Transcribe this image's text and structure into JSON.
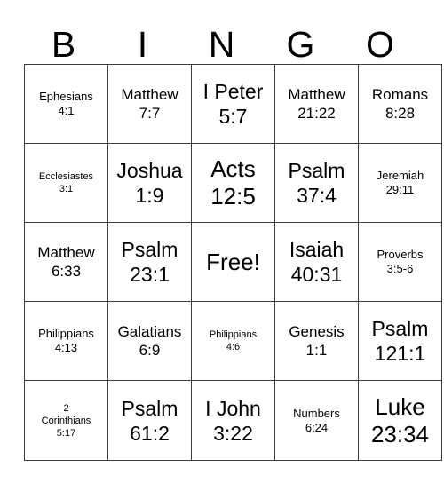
{
  "card": {
    "title": "BINGO",
    "header_letters": [
      "B",
      "I",
      "N",
      "G",
      "O"
    ],
    "free_space_label": "Free!",
    "border_color": "#3c3c3c",
    "text_color": "#000000",
    "background_color": "#ffffff",
    "columns": 5,
    "rows": 5,
    "cells": [
      [
        {
          "line1": "Ephesians",
          "line2": "4:1",
          "text": "Ephesians\n4:1",
          "size": "sm"
        },
        {
          "line1": "Matthew",
          "line2": "7:7",
          "text": "Matthew\n7:7",
          "size": "md"
        },
        {
          "line1": "I Peter",
          "line2": "5:7",
          "text": "I Peter\n5:7",
          "size": "lg"
        },
        {
          "line1": "Matthew",
          "line2": "21:22",
          "text": "Matthew\n21:22",
          "size": "md"
        },
        {
          "line1": "Romans",
          "line2": "8:28",
          "text": "Romans\n8:28",
          "size": "md"
        }
      ],
      [
        {
          "line1": "Ecclesiastes",
          "line2": "3:1",
          "text": "Ecclesiastes\n3:1",
          "size": "xs"
        },
        {
          "line1": "Joshua",
          "line2": "1:9",
          "text": "Joshua\n1:9",
          "size": "lg"
        },
        {
          "line1": "Acts",
          "line2": "12:5",
          "text": "Acts\n12:5",
          "size": "xl"
        },
        {
          "line1": "Psalm",
          "line2": "37:4",
          "text": "Psalm\n37:4",
          "size": "lg"
        },
        {
          "line1": "Jeremiah",
          "line2": "29:11",
          "text": "Jeremiah\n29:11",
          "size": "sm"
        }
      ],
      [
        {
          "line1": "Matthew",
          "line2": "6:33",
          "text": "Matthew\n6:33",
          "size": "md"
        },
        {
          "line1": "Psalm",
          "line2": "23:1",
          "text": "Psalm\n23:1",
          "size": "lg"
        },
        {
          "line1": "Free!",
          "line2": "",
          "text": "Free!",
          "size": "xl",
          "free": true
        },
        {
          "line1": "Isaiah",
          "line2": "40:31",
          "text": "Isaiah\n40:31",
          "size": "lg"
        },
        {
          "line1": "Proverbs",
          "line2": "3:5-6",
          "text": "Proverbs\n3:5-6",
          "size": "sm"
        }
      ],
      [
        {
          "line1": "Philippians",
          "line2": "4:13",
          "text": "Philippians\n4:13",
          "size": "sm"
        },
        {
          "line1": "Galatians",
          "line2": "6:9",
          "text": "Galatians\n6:9",
          "size": "md"
        },
        {
          "line1": "Philippians",
          "line2": "4:6",
          "text": "Philippians\n4:6",
          "size": "xs"
        },
        {
          "line1": "Genesis",
          "line2": "1:1",
          "text": "Genesis\n1:1",
          "size": "md"
        },
        {
          "line1": "Psalm",
          "line2": "121:1",
          "text": "Psalm\n121:1",
          "size": "lg"
        }
      ],
      [
        {
          "line1": "2 Corinthians",
          "line2": "5:17",
          "text": "2\nCorinthians\n5:17",
          "size": "xs"
        },
        {
          "line1": "Psalm",
          "line2": "61:2",
          "text": "Psalm\n61:2",
          "size": "lg"
        },
        {
          "line1": "I John",
          "line2": "3:22",
          "text": "I John\n3:22",
          "size": "lg"
        },
        {
          "line1": "Numbers",
          "line2": "6:24",
          "text": "Numbers\n6:24",
          "size": "sm"
        },
        {
          "line1": "Luke",
          "line2": "23:34",
          "text": "Luke\n23:34",
          "size": "xl"
        }
      ]
    ]
  }
}
